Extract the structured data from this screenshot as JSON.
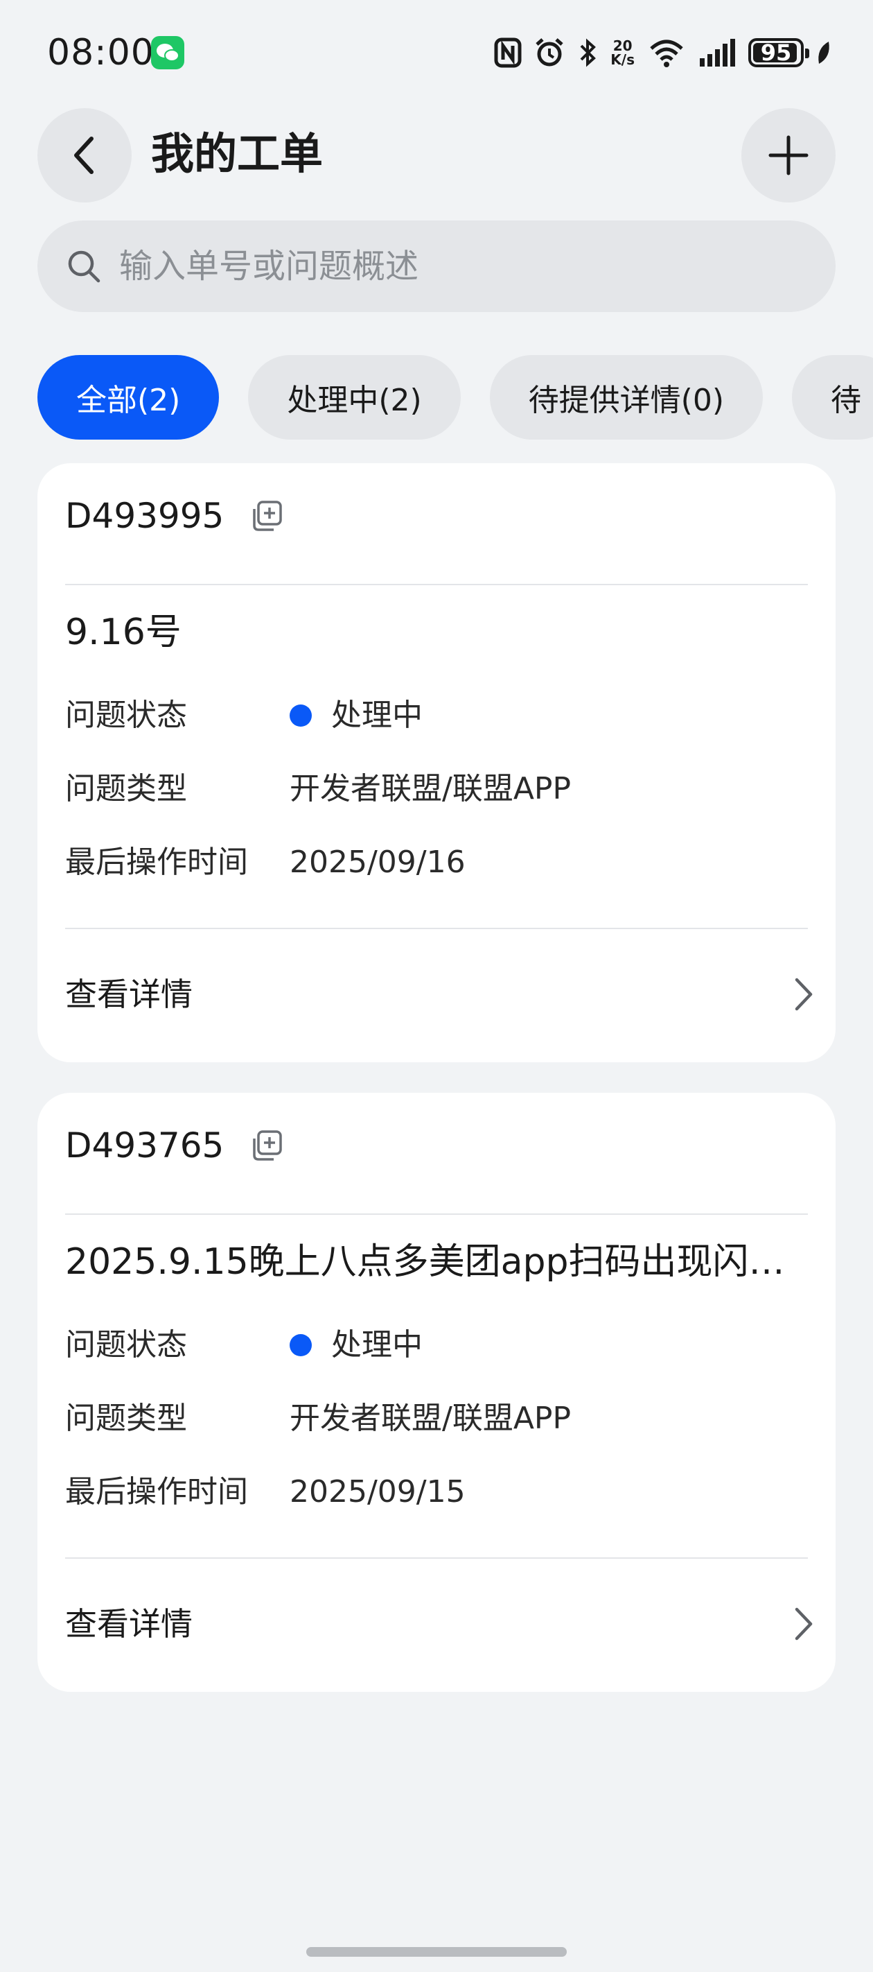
{
  "status_bar": {
    "time": "08:00",
    "app_icon": "wechat-icon",
    "net_speed_value": "20",
    "net_speed_unit": "K/s",
    "battery": "95",
    "battery_level": 0.95
  },
  "header": {
    "title": "我的工单",
    "back_icon": "chevron-left-icon",
    "add_icon": "plus-icon"
  },
  "search": {
    "placeholder": "输入单号或问题概述",
    "value": ""
  },
  "tabs": [
    {
      "label": "全部(2)",
      "active": true
    },
    {
      "label": "处理中(2)",
      "active": false
    },
    {
      "label": "待提供详情(0)",
      "active": false
    },
    {
      "label": "待",
      "active": false
    }
  ],
  "tickets": [
    {
      "id": "D493995",
      "title": "9.16号",
      "status_label": "问题状态",
      "status": "处理中",
      "type_label": "问题类型",
      "type": "开发者联盟/联盟APP",
      "time_label": "最后操作时间",
      "time": "2025/09/16",
      "detail_label": "查看详情"
    },
    {
      "id": "D493765",
      "title": "2025.9.15晚上八点多美团app扫码出现闪…",
      "status_label": "问题状态",
      "status": "处理中",
      "type_label": "问题类型",
      "type": "开发者联盟/联盟APP",
      "time_label": "最后操作时间",
      "time": "2025/09/15",
      "detail_label": "查看详情"
    }
  ],
  "colors": {
    "accent": "#0a59f7",
    "background": "#f1f3f5",
    "card": "#ffffff",
    "pill": "#e4e6e9"
  }
}
